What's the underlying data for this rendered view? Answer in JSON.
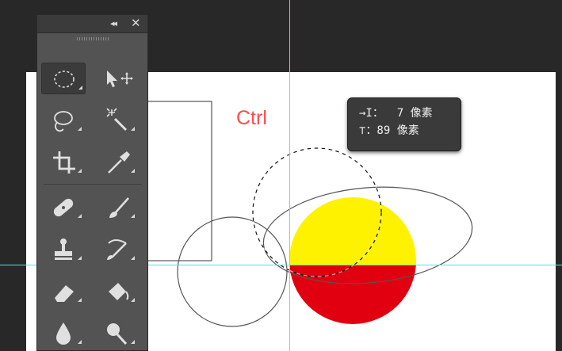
{
  "canvas": {
    "annotation": "Ctrl",
    "annotation_color": "#ff4b4b",
    "guide_color": "#4fe3ee",
    "fill_yellow": "#fff200",
    "fill_red": "#e10010"
  },
  "tooltip": {
    "row1": "→I：  7 像素",
    "row2": "⊤：89 像素"
  },
  "tools_panel": {
    "collapse_glyph": "◂◂",
    "close_glyph": "✕",
    "tools": [
      {
        "name": "elliptical-marquee",
        "icon": "ellipse-marquee-icon",
        "active": true
      },
      {
        "name": "move",
        "icon": "move-icon"
      },
      {
        "name": "lasso",
        "icon": "lasso-icon"
      },
      {
        "name": "magic-wand",
        "icon": "magic-wand-icon"
      },
      {
        "name": "crop",
        "icon": "crop-icon"
      },
      {
        "name": "eyedropper",
        "icon": "eyedropper-icon"
      },
      {
        "name": "spot-healing",
        "icon": "bandage-icon"
      },
      {
        "name": "brush",
        "icon": "brush-icon"
      },
      {
        "name": "clone-stamp",
        "icon": "stamp-icon"
      },
      {
        "name": "history-brush",
        "icon": "history-brush-icon"
      },
      {
        "name": "eraser",
        "icon": "eraser-icon"
      },
      {
        "name": "paint-bucket",
        "icon": "paint-bucket-icon"
      },
      {
        "name": "blur",
        "icon": "blur-drop-icon"
      },
      {
        "name": "dodge",
        "icon": "dodge-icon"
      }
    ]
  }
}
